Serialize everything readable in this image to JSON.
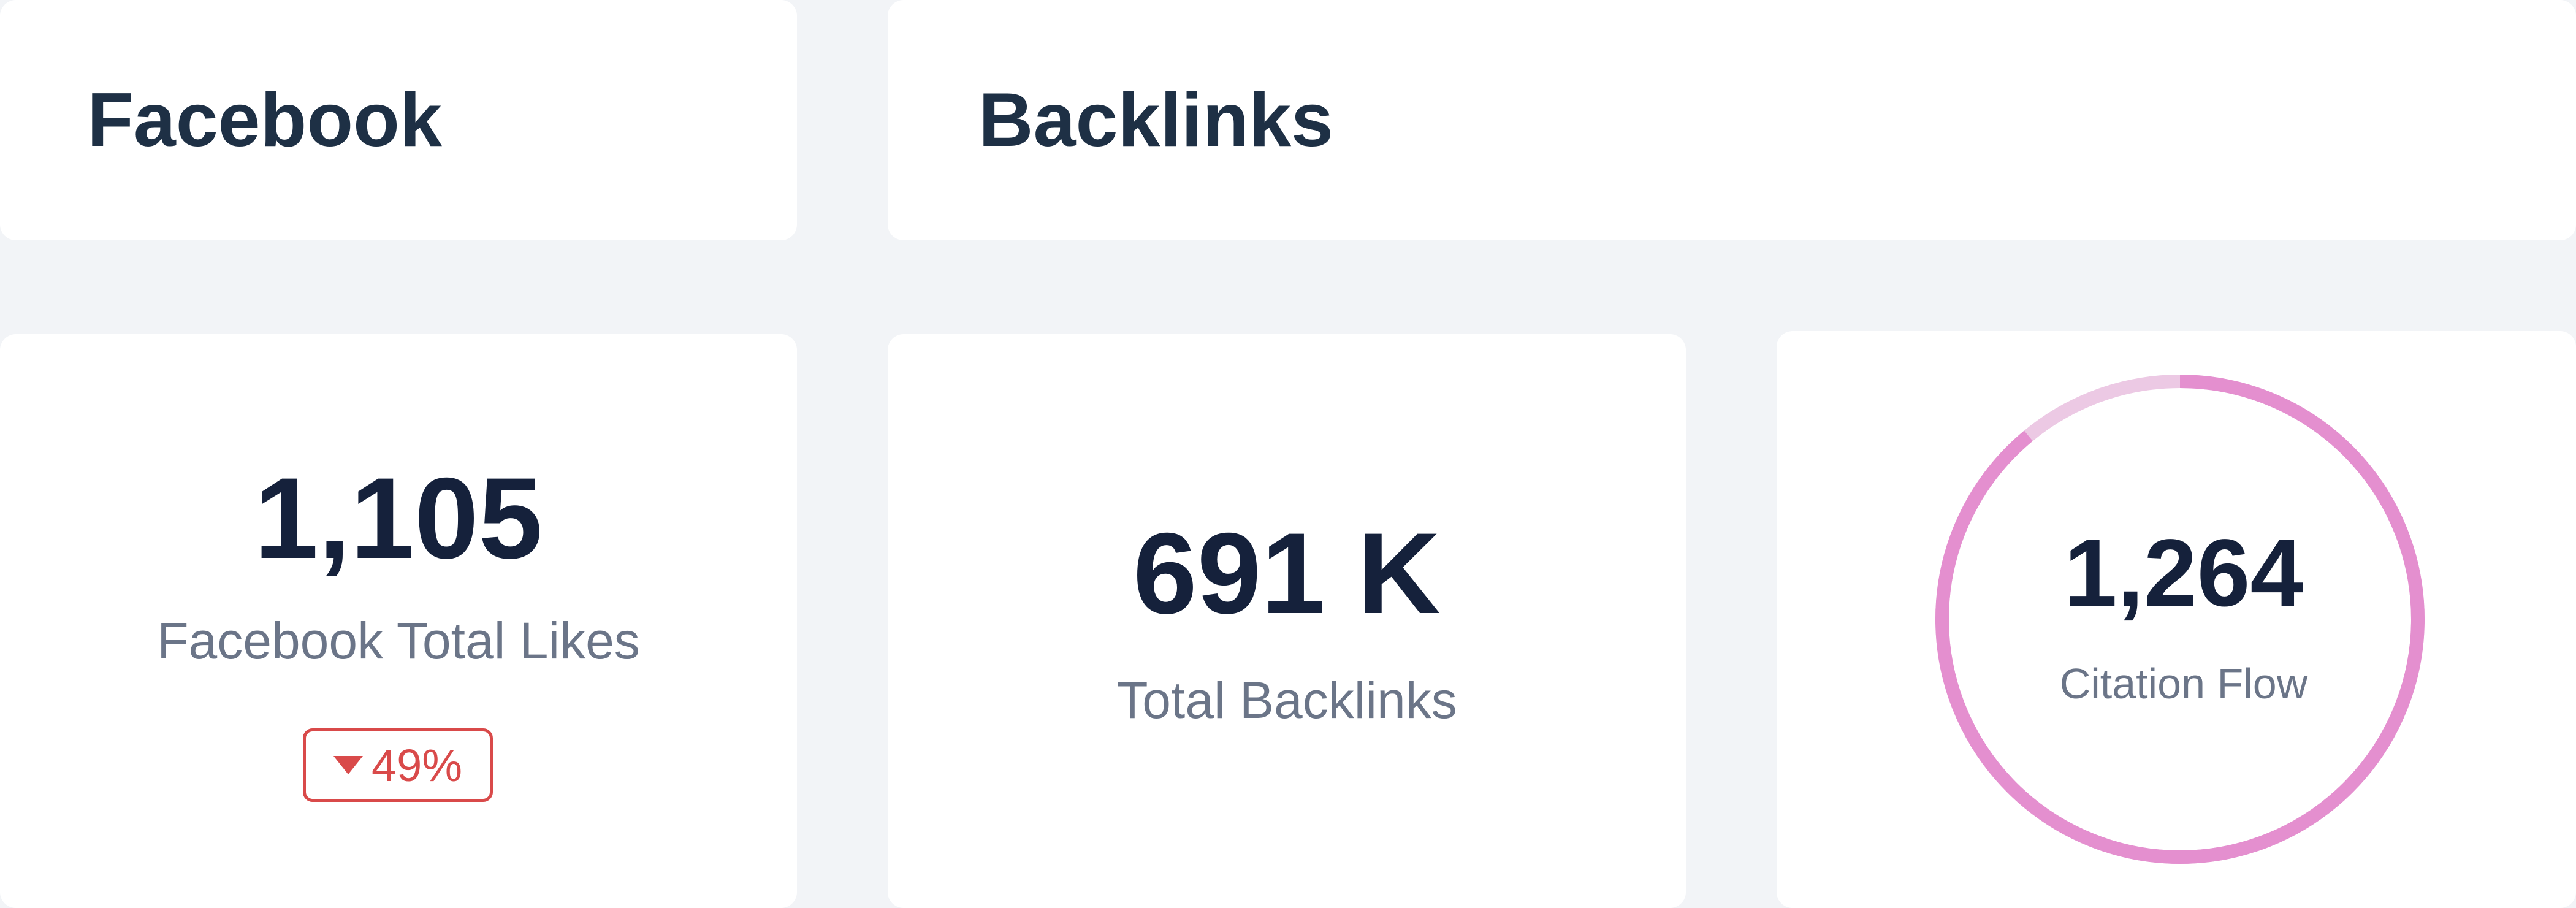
{
  "facebook_header": {
    "title": "Facebook"
  },
  "backlinks_header": {
    "title": "Backlinks"
  },
  "facebook_likes": {
    "value": "1,105",
    "label": "Facebook Total Likes",
    "change": {
      "direction": "down",
      "text": "49%",
      "color": "#d94a4a"
    }
  },
  "total_backlinks": {
    "value": "691 K",
    "label": "Total Backlinks"
  },
  "citation_flow": {
    "value": "1,264",
    "label": "Citation Flow",
    "ring": {
      "fill_fraction": 0.89,
      "fill_color": "#e48fcf",
      "track_color": "#ecc9e4"
    }
  },
  "colors": {
    "background": "#f2f4f7",
    "card": "#ffffff",
    "title_text": "#1e3045",
    "value_text": "#15213b",
    "label_text": "#6b7588"
  }
}
